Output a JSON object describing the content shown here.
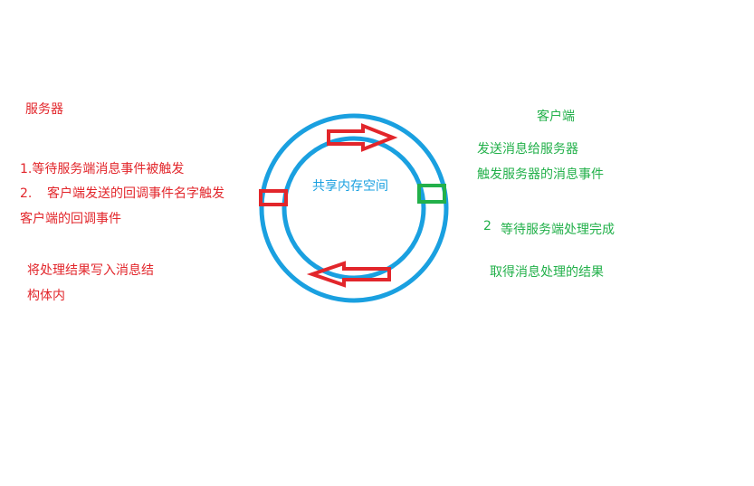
{
  "server": {
    "title": "服务器",
    "step1": "1.等待服务端消息事件被触发",
    "step2_num": "2.",
    "step2_line1": "客户端发送的回调事件名字触发",
    "step2_line2": "客户端的回调事件",
    "step3_line1": "将处理结果写入消息结",
    "step3_line2": "构体内"
  },
  "client": {
    "title": "客户端",
    "line1": "发送消息给服务器",
    "line2": "触发服务器的消息事件",
    "step2_num": "2",
    "step2": "等待服务端处理完成",
    "result": "取得消息处理的结果"
  },
  "center": {
    "label": "共享内存空间"
  },
  "colors": {
    "server": "#e2262b",
    "client": "#22b04a",
    "ring": "#1aa0e0"
  }
}
